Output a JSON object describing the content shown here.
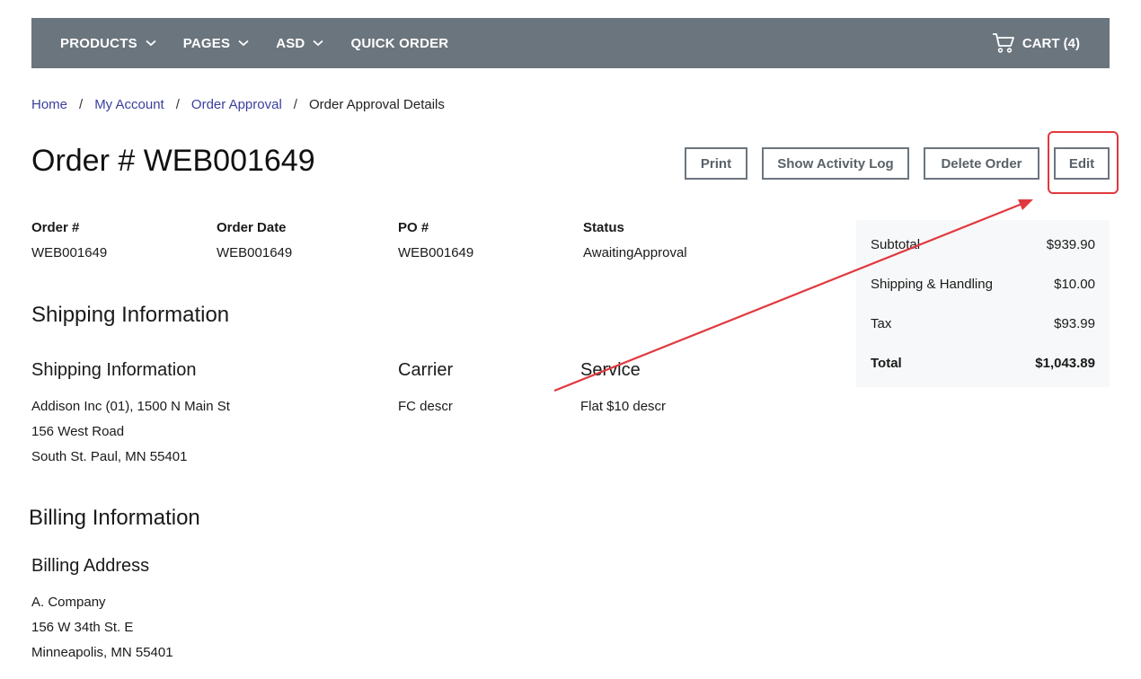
{
  "nav": {
    "items": [
      {
        "label": "PRODUCTS",
        "has_dropdown": true
      },
      {
        "label": "PAGES",
        "has_dropdown": true
      },
      {
        "label": "ASD",
        "has_dropdown": true
      },
      {
        "label": "QUICK ORDER",
        "has_dropdown": false
      }
    ],
    "cart_label": "CART (4)"
  },
  "breadcrumb": {
    "items": [
      "Home",
      "My Account",
      "Order Approval"
    ],
    "separator": "/",
    "current": "Order Approval Details"
  },
  "page_title": "Order # WEB001649",
  "actions": {
    "print": "Print",
    "activity_log": "Show Activity Log",
    "delete": "Delete Order",
    "edit": "Edit"
  },
  "order_info": [
    {
      "label": "Order #",
      "value": "WEB001649"
    },
    {
      "label": "Order Date",
      "value": "WEB001649"
    },
    {
      "label": "PO #",
      "value": "WEB001649"
    },
    {
      "label": "Status",
      "value": "AwaitingApproval"
    }
  ],
  "summary": {
    "rows": [
      {
        "label": "Subtotal",
        "value": "$939.90"
      },
      {
        "label": "Shipping & Handling",
        "value": "$10.00"
      },
      {
        "label": "Tax",
        "value": "$93.99"
      }
    ],
    "total": {
      "label": "Total",
      "value": "$1,043.89"
    }
  },
  "shipping": {
    "section_title": "Shipping Information",
    "address_title": "Shipping Information",
    "address_lines": [
      "Addison Inc (01), 1500 N Main St",
      "156 West Road",
      "South St. Paul, MN 55401"
    ],
    "carrier_title": "Carrier",
    "carrier_value": "FC descr",
    "service_title": "Service",
    "service_value": "Flat $10 descr"
  },
  "billing": {
    "section_title": "Billing Information",
    "address_title": "Billing Address",
    "address_lines": [
      "A. Company",
      "156 W 34th St. E",
      "Minneapolis, MN 55401"
    ]
  },
  "colors": {
    "nav_bg": "#6b757e",
    "link": "#3a3f9c",
    "annotation": "#e0393e",
    "summary_bg": "#f7f8f9"
  },
  "icons": {
    "nav_dropdown": "chevron-down-icon",
    "cart": "cart-icon"
  }
}
